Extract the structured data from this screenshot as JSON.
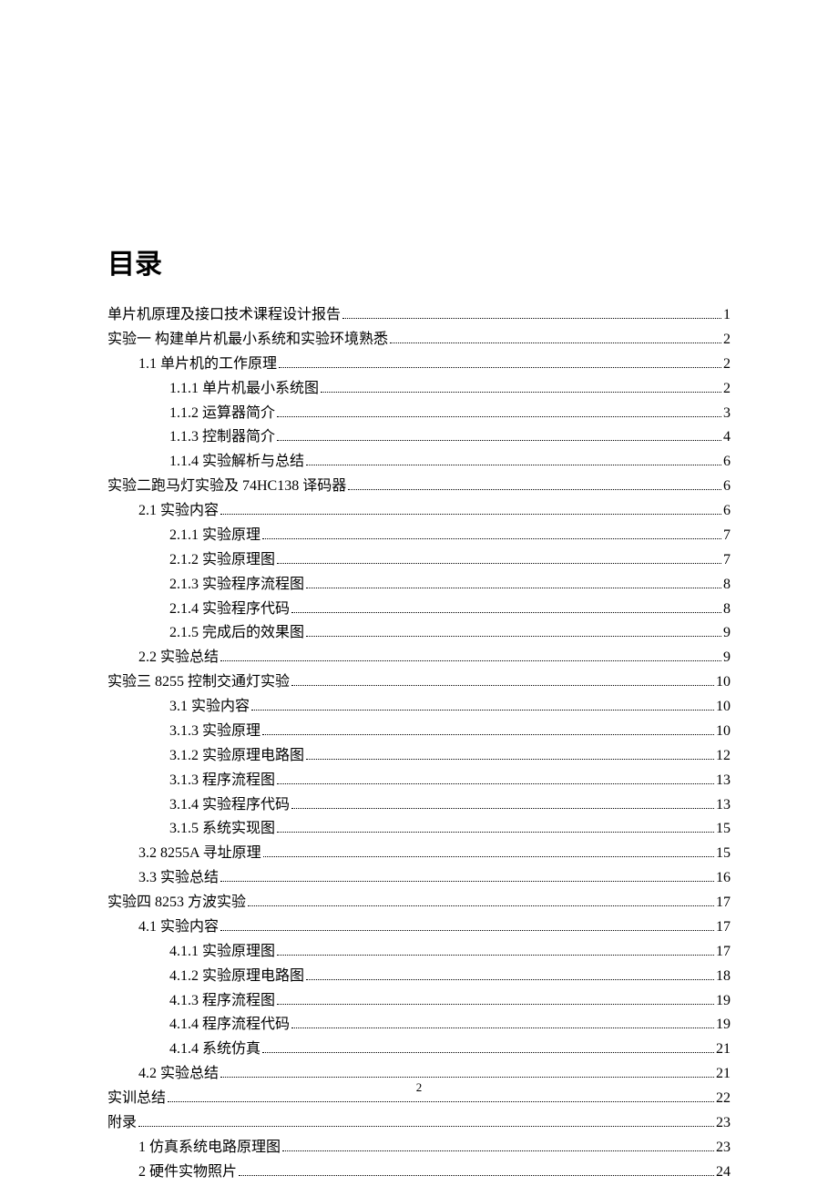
{
  "title": "目录",
  "page_number": "2",
  "toc": [
    {
      "indent": 0,
      "label": "单片机原理及接口技术课程设计报告",
      "page": "1"
    },
    {
      "indent": 0,
      "label": "实验一  构建单片机最小系统和实验环境熟悉",
      "page": "2"
    },
    {
      "indent": 1,
      "label": "1.1 单片机的工作原理",
      "page": "2"
    },
    {
      "indent": 2,
      "label": "1.1.1 单片机最小系统图",
      "page": "2"
    },
    {
      "indent": 2,
      "label": "1.1.2 运算器简介",
      "page": "3"
    },
    {
      "indent": 2,
      "label": "1.1.3 控制器简介",
      "page": "4"
    },
    {
      "indent": 2,
      "label": "1.1.4 实验解析与总结",
      "page": "6"
    },
    {
      "indent": 0,
      "label": "实验二跑马灯实验及 74HC138 译码器",
      "page": "6"
    },
    {
      "indent": 1,
      "label": "2.1 实验内容",
      "page": "6"
    },
    {
      "indent": 2,
      "label": "2.1.1 实验原理",
      "page": "7"
    },
    {
      "indent": 2,
      "label": "2.1.2 实验原理图",
      "page": "7"
    },
    {
      "indent": 2,
      "label": "2.1.3 实验程序流程图",
      "page": "8"
    },
    {
      "indent": 2,
      "label": "2.1.4 实验程序代码",
      "page": "8"
    },
    {
      "indent": 2,
      "label": "2.1.5 完成后的效果图",
      "page": "9"
    },
    {
      "indent": 1,
      "label": "2.2 实验总结",
      "page": "9"
    },
    {
      "indent": 0,
      "label": "实验三  8255 控制交通灯实验",
      "page": "10"
    },
    {
      "indent": 2,
      "label": "3.1 实验内容",
      "page": "10"
    },
    {
      "indent": 2,
      "label": "3.1.3 实验原理",
      "page": "10"
    },
    {
      "indent": 2,
      "label": "3.1.2 实验原理电路图",
      "page": "12"
    },
    {
      "indent": 2,
      "label": "3.1.3 程序流程图",
      "page": "13"
    },
    {
      "indent": 2,
      "label": "3.1.4 实验程序代码",
      "page": "13"
    },
    {
      "indent": 2,
      "label": "3.1.5 系统实现图",
      "page": "15"
    },
    {
      "indent": 1,
      "label": "3.2 8255A 寻址原理",
      "page": "15"
    },
    {
      "indent": 1,
      "label": "3.3 实验总结",
      "page": "16"
    },
    {
      "indent": 0,
      "label": "实验四  8253 方波实验",
      "page": "17"
    },
    {
      "indent": 1,
      "label": "4.1 实验内容",
      "page": "17"
    },
    {
      "indent": 2,
      "label": "4.1.1 实验原理图",
      "page": "17"
    },
    {
      "indent": 2,
      "label": "4.1.2 实验原理电路图",
      "page": "18"
    },
    {
      "indent": 2,
      "label": "4.1.3 程序流程图",
      "page": "19"
    },
    {
      "indent": 2,
      "label": "4.1.4 程序流程代码",
      "page": "19"
    },
    {
      "indent": 2,
      "label": "4.1.4 系统仿真",
      "page": "21"
    },
    {
      "indent": 1,
      "label": "4.2 实验总结",
      "page": "21"
    },
    {
      "indent": 0,
      "label": "实训总结",
      "page": "22"
    },
    {
      "indent": 0,
      "label": "附录",
      "page": "23"
    },
    {
      "indent": 1,
      "label": "1 仿真系统电路原理图",
      "page": "23"
    },
    {
      "indent": 1,
      "label": "2 硬件实物照片",
      "page": "24"
    }
  ]
}
